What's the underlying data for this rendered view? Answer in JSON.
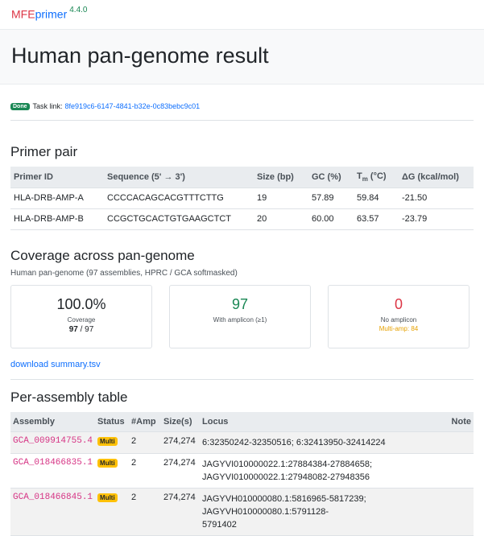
{
  "brand": {
    "mfe": "MFE",
    "primer": "primer",
    "version": "4.4.0"
  },
  "page_title": "Human pan-genome result",
  "task": {
    "badge": "Done",
    "label": "Task link:",
    "link": "8fe919c6-6147-4841-b32e-0c83bebc9c01"
  },
  "primer_pair": {
    "heading": "Primer pair",
    "columns": [
      "Primer ID",
      "Sequence (5' → 3')",
      "Size (bp)",
      "GC (%)",
      "T",
      "m",
      "(°C)",
      "ΔG (kcal/mol)"
    ],
    "rows": [
      {
        "id": "HLA-DRB-AMP-A",
        "seq": "CCCCACAGCACGTTTCTTG",
        "size": "19",
        "gc": "57.89",
        "tm": "59.84",
        "dg": "-21.50"
      },
      {
        "id": "HLA-DRB-AMP-B",
        "seq": "CCGCTGCACTGTGAAGCTCT",
        "size": "20",
        "gc": "60.00",
        "tm": "63.57",
        "dg": "-23.79"
      }
    ]
  },
  "coverage": {
    "heading": "Coverage across pan-genome",
    "subtitle": "Human pan-genome (97 assemblies, HPRC / GCA softmasked)",
    "card1": {
      "value": "100.0%",
      "label": "Coverage",
      "num": "97",
      "den": " / 97"
    },
    "card2": {
      "value": "97",
      "label": "With amplicon (≥1)"
    },
    "card3": {
      "value": "0",
      "label": "No amplicon",
      "extra": "Multi-amp: 84"
    },
    "download": "download summary.tsv"
  },
  "assembly": {
    "heading": "Per-assembly table",
    "columns": [
      "Assembly",
      "Status",
      "#Amp",
      "Size(s)",
      "Locus",
      "Note"
    ],
    "rows": [
      {
        "acc": "GCA_009914755.4",
        "status": "Multi",
        "amp": "2",
        "size": "274,274",
        "locus1": "6:32350242-32350516; 6:32413950-32414224",
        "locus2": ""
      },
      {
        "acc": "GCA_018466835.1",
        "status": "Multi",
        "amp": "2",
        "size": "274,274",
        "locus1": "JAGYVI010000022.1:27884384-27884658;",
        "locus2": "JAGYVI010000022.1:27948082-27948356"
      },
      {
        "acc": "GCA_018466845.1",
        "status": "Multi",
        "amp": "2",
        "size": "274,274",
        "locus1": "JAGYVH010000080.1:5816965-5817239; JAGYVH010000080.1:5791128-",
        "locus2": "5791402"
      }
    ]
  }
}
